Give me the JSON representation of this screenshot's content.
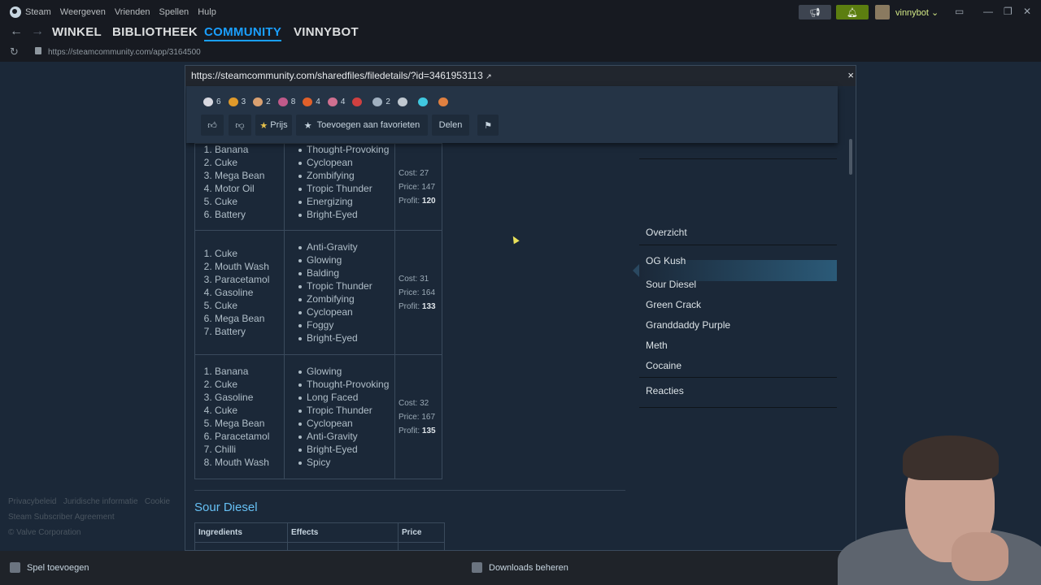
{
  "menubar": {
    "items": [
      "Steam",
      "Weergeven",
      "Vrienden",
      "Spellen",
      "Hulp"
    ],
    "user": "vinnybot"
  },
  "nav": {
    "tabs": [
      "WINKEL",
      "BIBLIOTHEEK",
      "COMMUNITY",
      "VINNYBOT"
    ],
    "active": "COMMUNITY"
  },
  "address": {
    "url": "https://steamcommunity.com/app/3164500"
  },
  "modal": {
    "url": "https://steamcommunity.com/sharedfiles/filedetails/?id=3461953113",
    "close": "×"
  },
  "toolbar": {
    "awards": [
      {
        "icon": "wings-award-icon",
        "count": "6",
        "color": "#d8d8e0"
      },
      {
        "icon": "horn-award-icon",
        "count": "3",
        "color": "#e09a2a"
      },
      {
        "icon": "cookie-award-icon",
        "count": "2",
        "color": "#d9a070"
      },
      {
        "icon": "cake-award-icon",
        "count": "8",
        "color": "#c05a8a"
      },
      {
        "icon": "flame-award-icon",
        "count": "4",
        "color": "#e0602a"
      },
      {
        "icon": "fish-award-icon",
        "count": "4",
        "color": "#d07090"
      },
      {
        "icon": "mushroom-award-icon",
        "count": "",
        "color": "#d04040"
      },
      {
        "icon": "helmet-award-icon",
        "count": "2",
        "color": "#a0b0c0"
      },
      {
        "icon": "cloud-award-icon",
        "count": "",
        "color": "#c0c8d0"
      },
      {
        "icon": "wand-award-icon",
        "count": "",
        "color": "#40c8e0"
      },
      {
        "icon": "gift-award-icon",
        "count": "",
        "color": "#e08040"
      }
    ],
    "prize_label": "Prijs",
    "favorite_label": "Toevoegen aan favorieten",
    "share_label": "Delen"
  },
  "recipes": [
    {
      "ingredients": [
        "Banana",
        "Cuke",
        "Mega Bean",
        "Motor Oil",
        "Cuke",
        "Battery"
      ],
      "effects": [
        "Thought-Provoking",
        "Cyclopean",
        "Zombifying",
        "Tropic Thunder",
        "Energizing",
        "Bright-Eyed"
      ],
      "cost_label": "Cost:",
      "cost": "27",
      "price_label": "Price:",
      "price": "147",
      "profit_label": "Profit:",
      "profit": "120"
    },
    {
      "ingredients": [
        "Cuke",
        "Mouth Wash",
        "Paracetamol",
        "Gasoline",
        "Cuke",
        "Mega Bean",
        "Battery"
      ],
      "effects": [
        "Anti-Gravity",
        "Glowing",
        "Balding",
        "Tropic Thunder",
        "Zombifying",
        "Cyclopean",
        "Foggy",
        "Bright-Eyed"
      ],
      "cost_label": "Cost:",
      "cost": "31",
      "price_label": "Price:",
      "price": "164",
      "profit_label": "Profit:",
      "profit": "133"
    },
    {
      "ingredients": [
        "Banana",
        "Cuke",
        "Gasoline",
        "Cuke",
        "Mega Bean",
        "Paracetamol",
        "Chilli",
        "Mouth Wash"
      ],
      "effects": [
        "Glowing",
        "Thought-Provoking",
        "Long Faced",
        "Tropic Thunder",
        "Cyclopean",
        "Anti-Gravity",
        "Bright-Eyed",
        "Spicy"
      ],
      "cost_label": "Cost:",
      "cost": "32",
      "price_label": "Price:",
      "price": "167",
      "profit_label": "Profit:",
      "profit": "135"
    }
  ],
  "sour_diesel": {
    "title": "Sour Diesel",
    "headers": [
      "Ingredients",
      "Effects",
      "Price"
    ]
  },
  "guide_nav": {
    "items": [
      "Overzicht",
      "OG Kush",
      "Sour Diesel",
      "Green Crack",
      "Granddaddy Purple",
      "Meth",
      "Cocaine",
      "Reacties"
    ],
    "selected": "OG Kush"
  },
  "footer": {
    "links": [
      "Privacybeleid",
      "Juridische informatie",
      "Cookie",
      "Steam Subscriber Agreement",
      "© Valve Corporation"
    ]
  },
  "bottombar": {
    "add_game": "Spel toevoegen",
    "downloads": "Downloads beheren"
  }
}
